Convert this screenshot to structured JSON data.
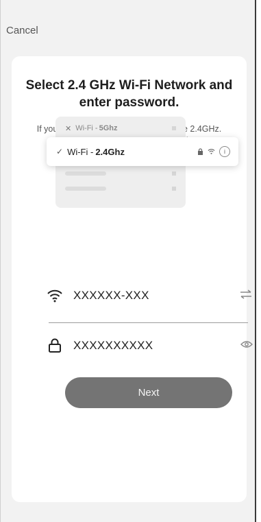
{
  "header": {
    "cancel_label": "Cancel"
  },
  "title": "Select 2.4 GHz Wi-Fi Network and enter password.",
  "description": "If your Wi-Fi is 5GHz, please set it to be 2.4GHz. Common router setting method",
  "illustration": {
    "row_5ghz_prefix": "Wi-Fi - ",
    "row_5ghz_band": "5Ghz",
    "row_24ghz_prefix": "Wi-Fi - ",
    "row_24ghz_band": "2.4Ghz",
    "info_glyph": "i"
  },
  "wifi": {
    "ssid": "XXXXXX-XXX",
    "icon": "wifi-icon",
    "trailing_icon": "swap-icon"
  },
  "password": {
    "value": "XXXXXXXXXX",
    "icon": "lock-icon",
    "trailing_icon": "eye-icon"
  },
  "next_label": "Next"
}
